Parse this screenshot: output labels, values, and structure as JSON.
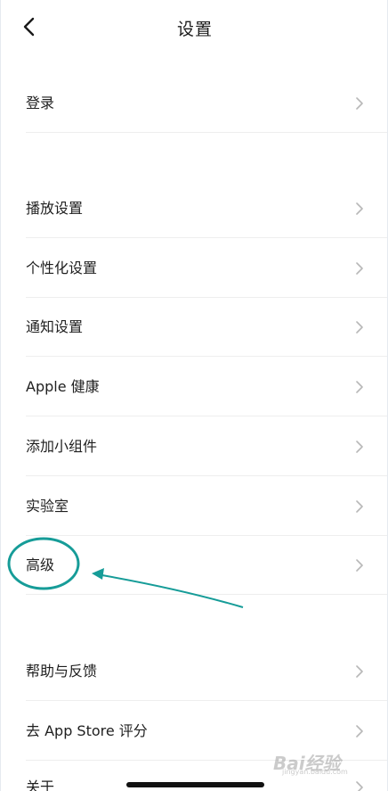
{
  "header": {
    "title": "设置",
    "back_icon": "chevron-left-icon"
  },
  "settings": {
    "login": "登录",
    "playback": "播放设置",
    "personalization": "个性化设置",
    "notifications": "通知设置",
    "apple_health": "Apple 健康",
    "add_widget": "添加小组件",
    "lab": "实验室",
    "advanced": "高级",
    "help_feedback": "帮助与反馈",
    "rate_app_store": "去 App Store 评分",
    "about": "关于"
  },
  "annotation": {
    "color": "#169c98",
    "highlighted_item": "高级"
  },
  "watermark": {
    "main": "Bai经验",
    "sub": "jingyan.baidu.com"
  }
}
